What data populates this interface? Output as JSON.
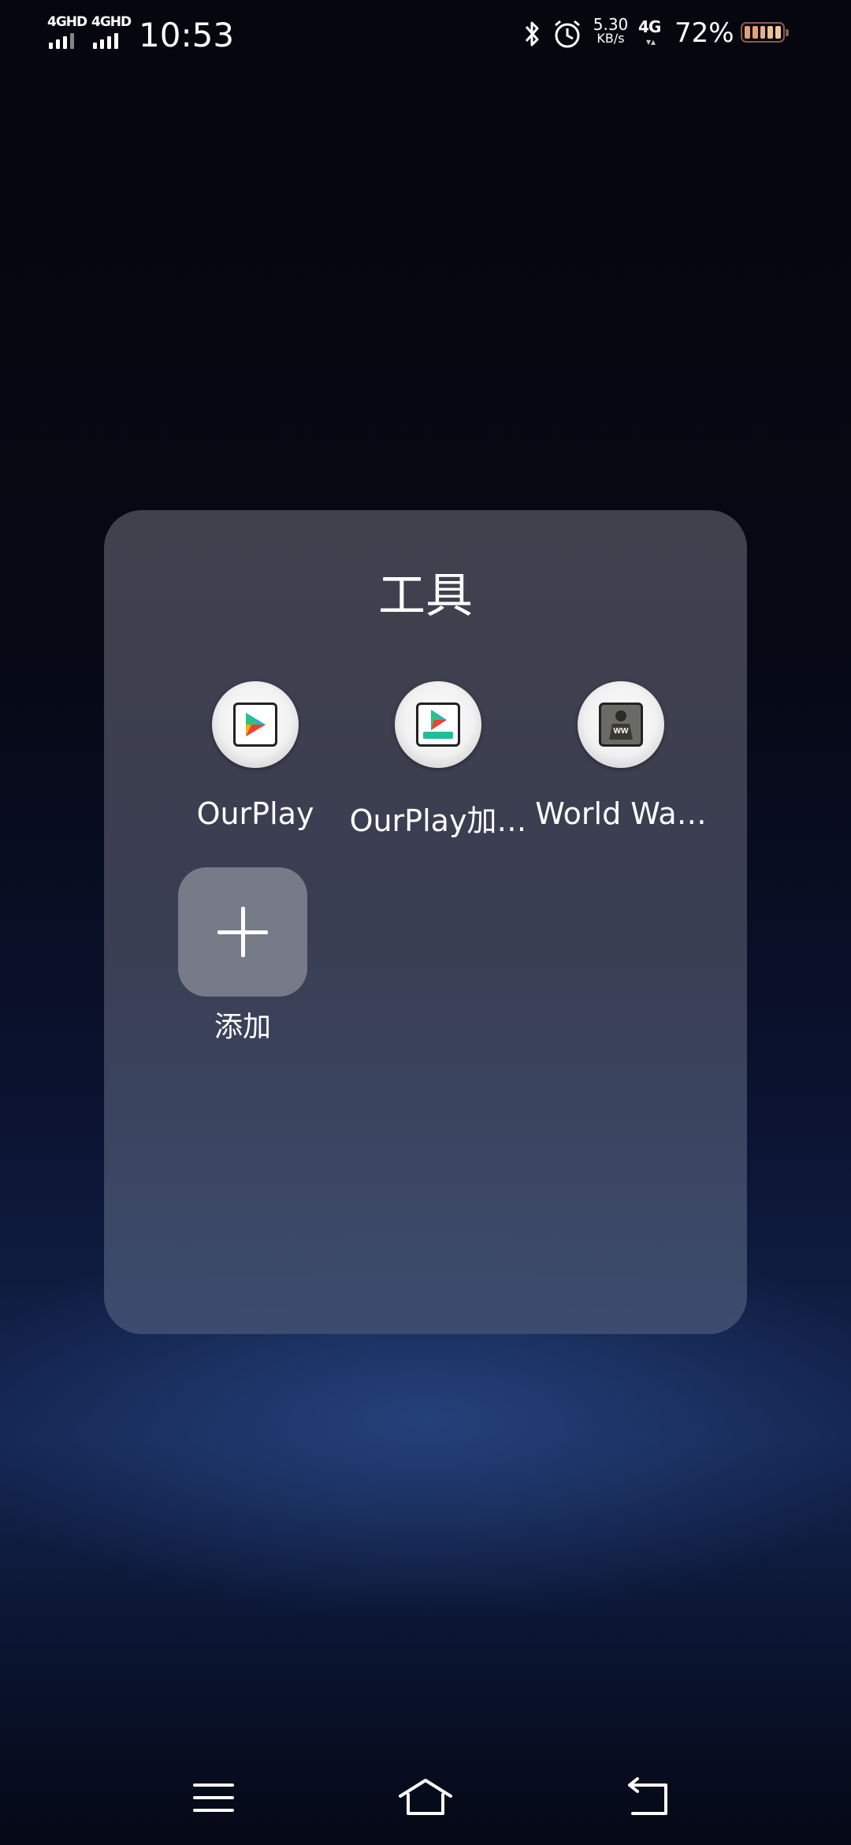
{
  "status_bar": {
    "sim1": "4GHD",
    "sim2": "4GHD",
    "time": "10:53",
    "net_speed_value": "5.30",
    "net_speed_unit": "KB/s",
    "network": "4G",
    "battery_percent": "72%",
    "battery_level": 0.72
  },
  "folder": {
    "title": "工具",
    "apps": [
      {
        "label": "OurPlay",
        "icon": "ourplay-icon"
      },
      {
        "label": "OurPlay加…",
        "icon": "ourplay-accelerator-icon"
      },
      {
        "label": "World Wa…",
        "icon": "world-war-game-icon"
      }
    ],
    "add_label": "添加"
  },
  "nav_bar": {
    "menu": "menu-icon",
    "home": "home-icon",
    "back": "back-icon"
  },
  "colors": {
    "folder_bg": "#464652",
    "add_tile": "#777a87",
    "battery_fill": "#d9a27a"
  }
}
